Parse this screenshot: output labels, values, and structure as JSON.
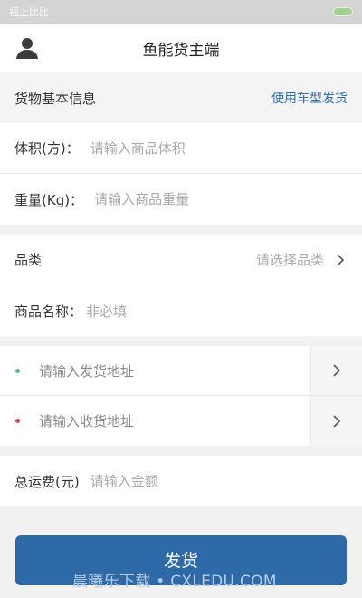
{
  "status_bar": {
    "carrier": "福上比比"
  },
  "header": {
    "title": "鱼能货主端",
    "avatar_icon": "user-avatar-icon"
  },
  "cargo_section": {
    "title": "货物基本信息",
    "link": "使用车型发货"
  },
  "volume": {
    "label": "体积(方)：",
    "placeholder": "请输入商品体积"
  },
  "weight": {
    "label": "重量(Kg)：",
    "placeholder": "请输入商品重量"
  },
  "category": {
    "label": "品类",
    "value": "请选择品类"
  },
  "product_name": {
    "label": "商品名称：",
    "value": "非必填"
  },
  "ship_address": {
    "placeholder": "请输入发货地址",
    "dot_color": "#4cb98a"
  },
  "receive_address": {
    "placeholder": "请输入收货地址",
    "dot_color": "#d94b4b"
  },
  "freight": {
    "label": "总运费(元)",
    "placeholder": "请输入金额"
  },
  "submit": {
    "label": "发货"
  },
  "watermark": "晨曦乐下载 • CXLEDU.COM",
  "colors": {
    "accent": "#2f6aa8",
    "link": "#2d6cb3"
  }
}
